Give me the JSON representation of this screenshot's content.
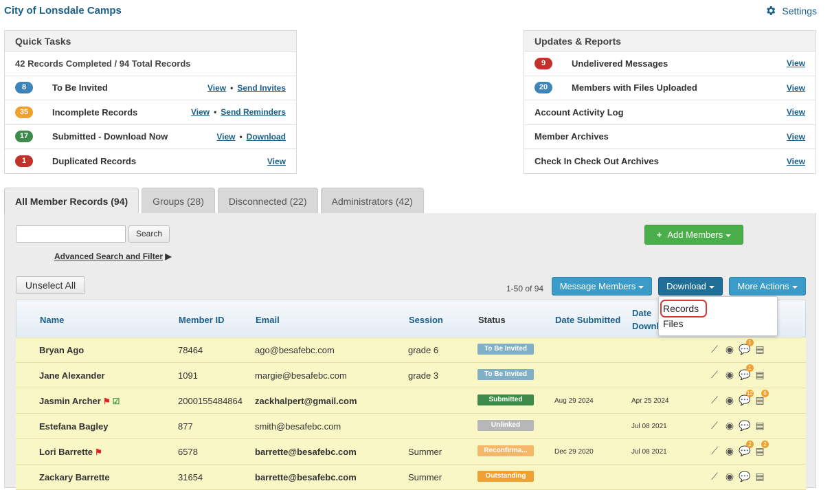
{
  "app": {
    "title": "City of Lonsdale Camps",
    "settings_label": "Settings"
  },
  "quick_tasks": {
    "title": "Quick Tasks",
    "summary": "42 Records Completed / 94 Total Records",
    "rows": [
      {
        "count": "8",
        "color": "#3d84b8",
        "label": "To Be Invited",
        "link1": "View",
        "link2": "Send Invites"
      },
      {
        "count": "35",
        "color": "#f0a030",
        "label": "Incomplete Records",
        "link1": "View",
        "link2": "Send Reminders"
      },
      {
        "count": "17",
        "color": "#3d8b4a",
        "label": "Submitted - Download Now",
        "link1": "View",
        "link2": "Download"
      },
      {
        "count": "1",
        "color": "#c0322b",
        "label": "Duplicated Records",
        "link1": "View"
      }
    ]
  },
  "updates": {
    "title": "Updates & Reports",
    "rows": [
      {
        "count": "9",
        "color": "#c0322b",
        "label": "Undelivered Messages",
        "link": "View"
      },
      {
        "count": "20",
        "color": "#3d84b8",
        "label": "Members with Files Uploaded",
        "link": "View"
      },
      {
        "label": "Account Activity Log",
        "link": "View"
      },
      {
        "label": "Member Archives",
        "link": "View"
      },
      {
        "label": "Check In Check Out Archives",
        "link": "View"
      }
    ]
  },
  "tabs": [
    {
      "label": "All Member Records (94)"
    },
    {
      "label": "Groups (28)"
    },
    {
      "label": "Disconnected (22)"
    },
    {
      "label": "Administrators (42)"
    }
  ],
  "toolbar": {
    "search_button": "Search",
    "search_placeholder": "",
    "advanced_search": "Advanced Search and Filter",
    "add_members": "Add Members",
    "unselect_all": "Unselect All",
    "count": "1-50 of 94",
    "message_members": "Message Members",
    "download": "Download",
    "more_actions": "More Actions"
  },
  "download_menu": {
    "items": [
      "Records",
      "Files"
    ]
  },
  "table": {
    "headers": {
      "name": "Name",
      "member_id": "Member ID",
      "email": "Email",
      "session": "Session",
      "status": "Status",
      "date_submitted": "Date Submitted",
      "date_downloaded_1": "Date",
      "date_downloaded_2": "Downl"
    },
    "rows": [
      {
        "name": "Bryan Ago",
        "member_id": "78464",
        "email": "ago@besafebc.com",
        "email_bold": false,
        "session": "grade 6",
        "status": "To Be Invited",
        "status_class": "st-inv",
        "date_submitted": "",
        "date_downloaded": "",
        "flag": false,
        "check": false,
        "badges": [
          "1"
        ]
      },
      {
        "name": "Jane Alexander",
        "member_id": "1091",
        "email": "margie@besafebc.com",
        "email_bold": false,
        "session": "grade 3",
        "status": "To Be Invited",
        "status_class": "st-inv",
        "date_submitted": "",
        "date_downloaded": "",
        "flag": false,
        "check": false,
        "badges": [
          "1"
        ]
      },
      {
        "name": "Jasmin Archer",
        "member_id": "2000155484864",
        "email": "zackhalpert@gmail.com",
        "email_bold": true,
        "session": "",
        "status": "Submitted",
        "status_class": "st-sub",
        "date_submitted": "Aug 29 2024",
        "date_downloaded": "Apr 25 2024",
        "flag": true,
        "check": true,
        "badges": [
          "12",
          "6"
        ]
      },
      {
        "name": "Estefana Bagley",
        "member_id": "877",
        "email": "smith@besafebc.com",
        "email_bold": false,
        "session": "",
        "status": "Unlinked",
        "status_class": "st-unl",
        "date_submitted": "",
        "date_downloaded": "Jul 08 2021",
        "flag": false,
        "check": false,
        "badges": []
      },
      {
        "name": "Lori Barrette",
        "member_id": "6578",
        "email": "barrette@besafebc.com",
        "email_bold": true,
        "session": "Summer",
        "status": "Reconfirma...",
        "status_class": "st-rec",
        "date_submitted": "Dec 29 2020",
        "date_downloaded": "Jul 08 2021",
        "flag": true,
        "check": false,
        "badges": [
          "2",
          "2"
        ]
      },
      {
        "name": "Zackary Barrette",
        "member_id": "31654",
        "email": "barrette@besafebc.com",
        "email_bold": true,
        "session": "Summer",
        "status": "Outstanding",
        "status_class": "st-out",
        "date_submitted": "",
        "date_downloaded": "",
        "flag": false,
        "check": false,
        "badges": []
      }
    ]
  }
}
